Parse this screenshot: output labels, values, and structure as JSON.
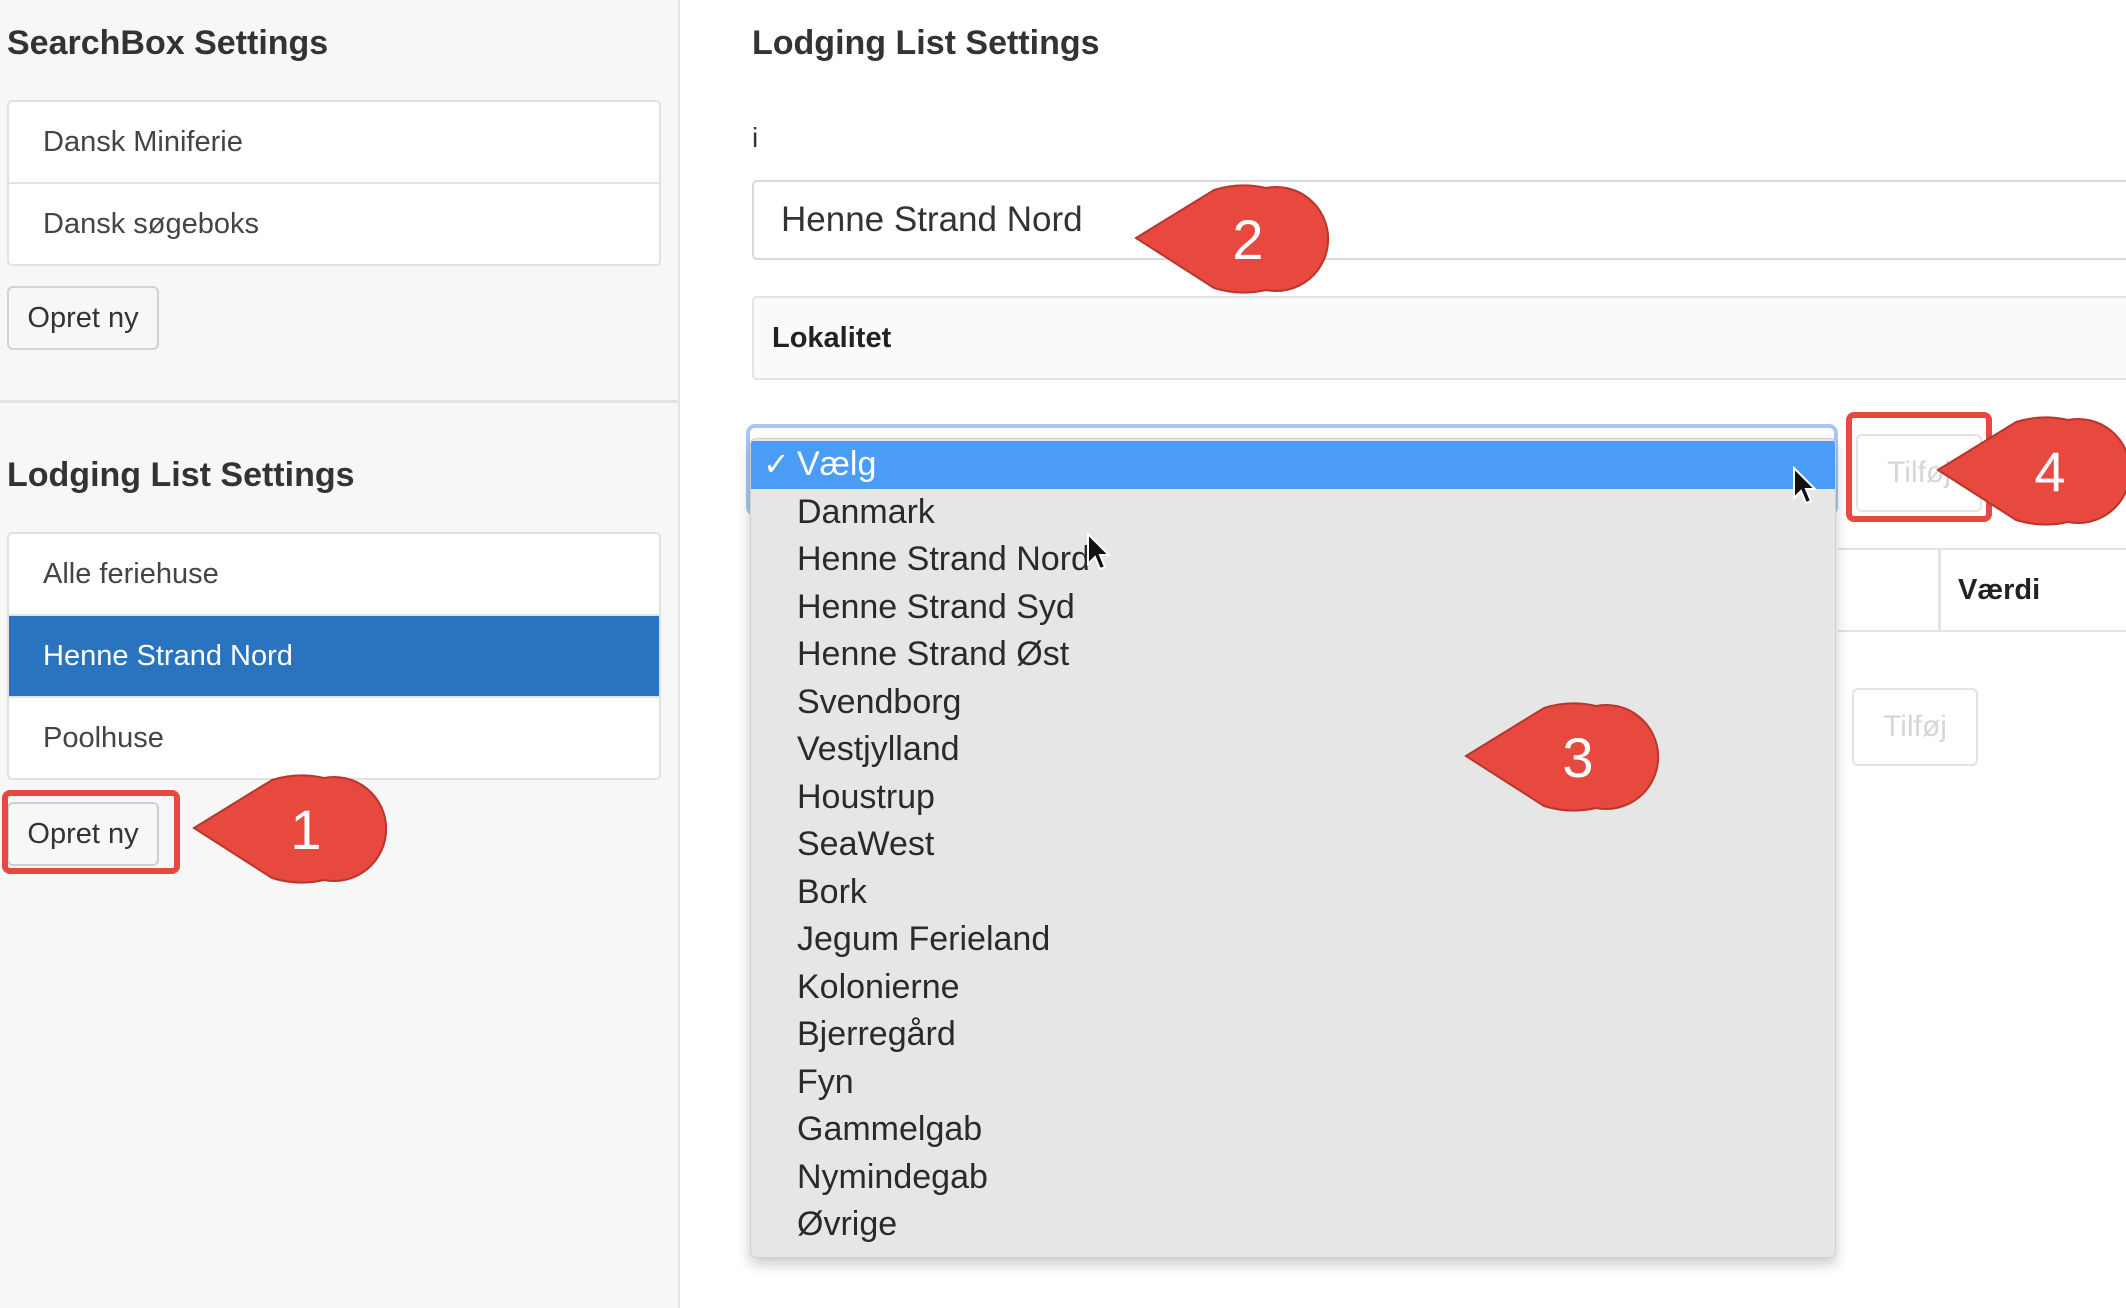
{
  "sidebar": {
    "searchbox_heading": "SearchBox Settings",
    "searchbox_items": [
      {
        "label": "Dansk Miniferie"
      },
      {
        "label": "Dansk søgeboks"
      }
    ],
    "searchbox_create_label": "Opret ny",
    "lodging_heading": "Lodging List Settings",
    "lodging_items": [
      {
        "label": "Alle feriehuse",
        "active": false
      },
      {
        "label": "Henne Strand Nord",
        "active": true
      },
      {
        "label": "Poolhuse",
        "active": false
      }
    ],
    "lodging_create_label": "Opret ny"
  },
  "main": {
    "heading": "Lodging List Settings",
    "name_label": "i",
    "name_value": "Henne Strand Nord",
    "filter_panel_heading": "Lokalitet",
    "add_button_label": "Tilføj",
    "value_column_header": "Værdi",
    "add_value_button_label": "Tilføj"
  },
  "dropdown": {
    "selected_label": "Vælg",
    "check_glyph": "✓",
    "options": [
      {
        "label": "Danmark"
      },
      {
        "label": "Henne Strand Nord"
      },
      {
        "label": "Henne Strand Syd"
      },
      {
        "label": "Henne Strand Øst"
      },
      {
        "label": "Svendborg"
      },
      {
        "label": "Vestjylland"
      },
      {
        "label": "Houstrup"
      },
      {
        "label": "SeaWest"
      },
      {
        "label": "Bork"
      },
      {
        "label": "Jegum Ferieland"
      },
      {
        "label": "Kolonierne"
      },
      {
        "label": "Bjerregård"
      },
      {
        "label": "Fyn"
      },
      {
        "label": "Gammelgab"
      },
      {
        "label": "Nymindegab"
      },
      {
        "label": "Øvrige"
      }
    ]
  },
  "annotations": {
    "callout_1": "1",
    "callout_2": "2",
    "callout_3": "3",
    "callout_4": "4"
  },
  "colors": {
    "active_item": "#2a74bf",
    "dropdown_highlight": "#4a9cf7",
    "annotation_red": "#e8493e"
  }
}
